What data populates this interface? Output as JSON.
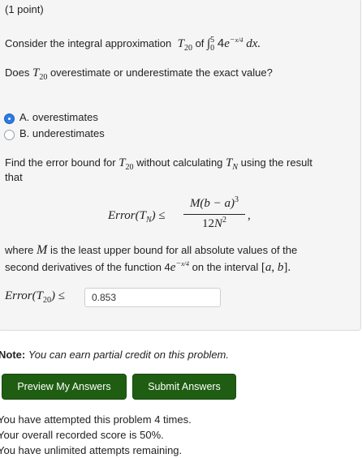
{
  "problem": {
    "points": "(1 point)",
    "intro_text": "Consider the integral approximation",
    "intro_of": "of",
    "question1": "Does",
    "question1_rest": "overestimate or underestimate the exact value?",
    "choices": [
      {
        "label": "A. overestimates",
        "selected": true
      },
      {
        "label": "B. underestimates",
        "selected": false
      }
    ],
    "find_text_1": "Find the error bound for",
    "find_text_2": "without calculating",
    "find_text_3": "using the result",
    "find_text_4": "that",
    "where_text_1": "where",
    "where_text_2": "is the least upper bound for all absolute values of the",
    "second_line_1": "second derivatives of the function 4",
    "second_line_2": "on the interval",
    "answer_value": "0.853"
  },
  "note": {
    "label": "Note:",
    "text": "You can earn partial credit on this problem."
  },
  "buttons": {
    "preview": "Preview My Answers",
    "submit": "Submit Answers"
  },
  "status": [
    "You have attempted this problem 4 times.",
    "Your overall recorded score is 50%.",
    "You have unlimited attempts remaining."
  ],
  "colors": {
    "button_bg": "#1f5e12",
    "radio_selected": "#2b7be4"
  }
}
